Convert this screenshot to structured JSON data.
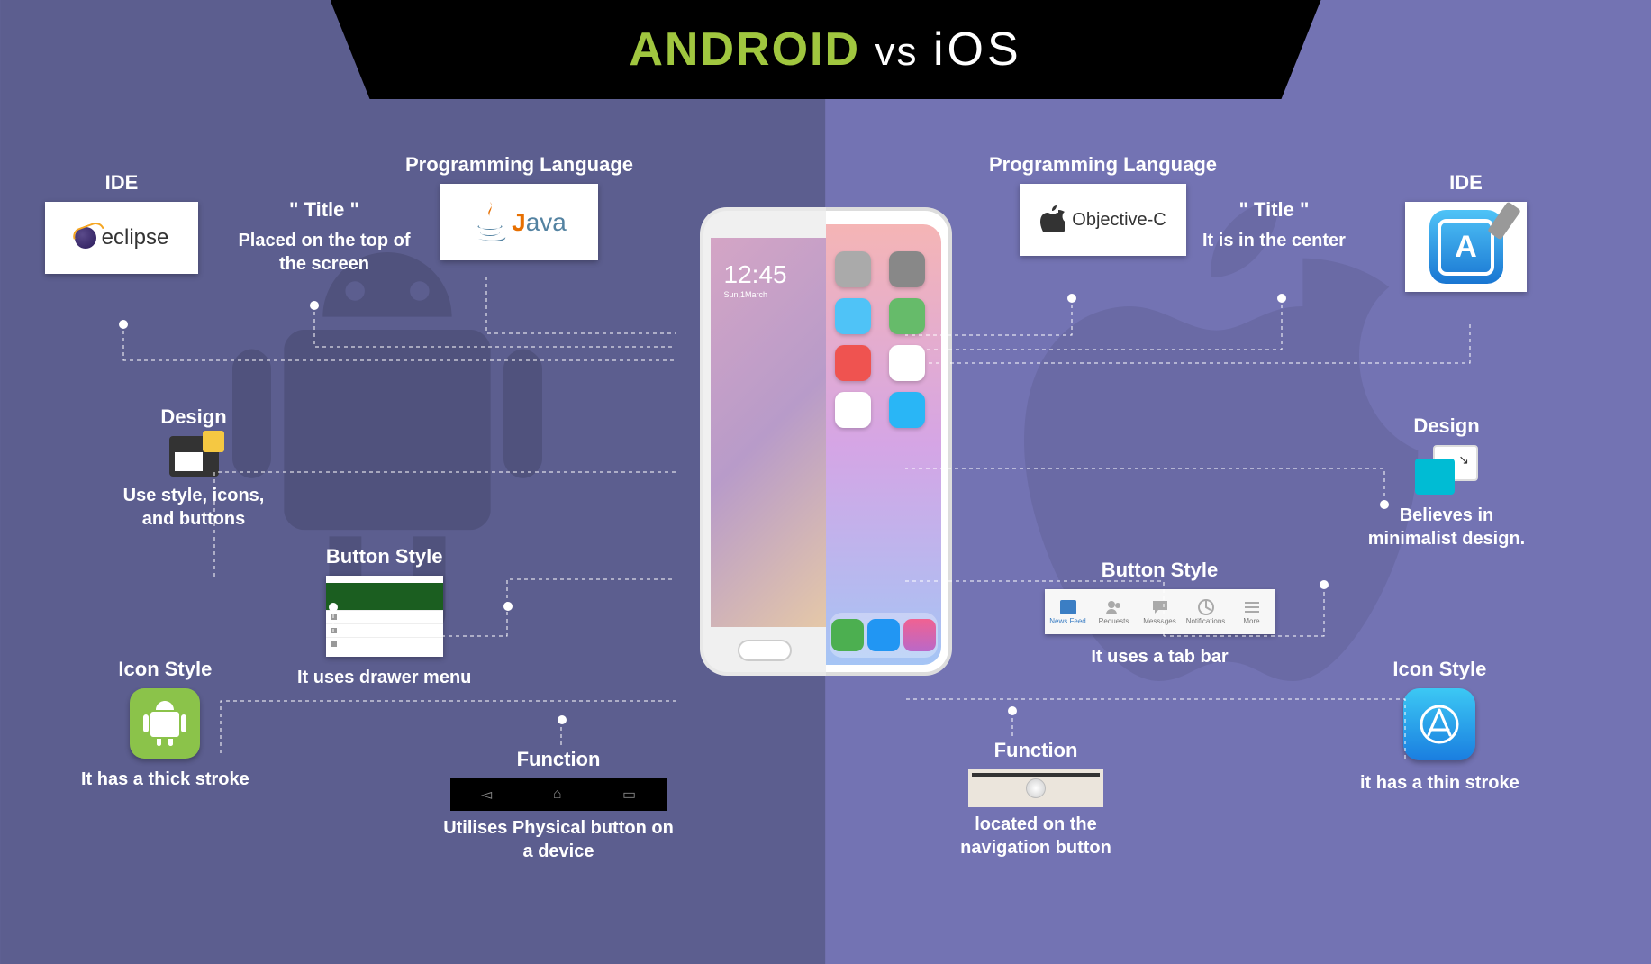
{
  "banner": {
    "android": "ANDROID",
    "vs": "vs",
    "ios": "iOS"
  },
  "phone": {
    "time": "12:45",
    "date": "Sun,1March"
  },
  "android": {
    "ide": {
      "title": "IDE",
      "brand": "eclipse"
    },
    "title": {
      "title": "\" Title \"",
      "desc": "Placed on the top of the screen"
    },
    "lang": {
      "title": "Programming Language",
      "brand_prefix": "J",
      "brand_rest": "ava"
    },
    "design": {
      "title": "Design",
      "desc": "Use style, icons, and buttons"
    },
    "button": {
      "title": "Button Style",
      "desc": "It uses drawer menu"
    },
    "iconstyle": {
      "title": "Icon Style",
      "desc": "It has a thick stroke"
    },
    "function": {
      "title": "Function",
      "desc": "Utilises Physical button on a device"
    }
  },
  "ios": {
    "lang": {
      "title": "Programming Language",
      "brand": "Objective-C"
    },
    "title": {
      "title": "\" Title \"",
      "desc": "It is in the center"
    },
    "ide": {
      "title": "IDE"
    },
    "design": {
      "title": "Design",
      "desc": "Believes in minimalist design."
    },
    "button": {
      "title": "Button Style",
      "desc": "It uses a tab bar",
      "tabs": [
        "News Feed",
        "Requests",
        "Messages",
        "Notifications",
        "More"
      ]
    },
    "iconstyle": {
      "title": "Icon Style",
      "desc": "it has a thin stroke"
    },
    "function": {
      "title": "Function",
      "desc": "located on the navigation button"
    }
  }
}
